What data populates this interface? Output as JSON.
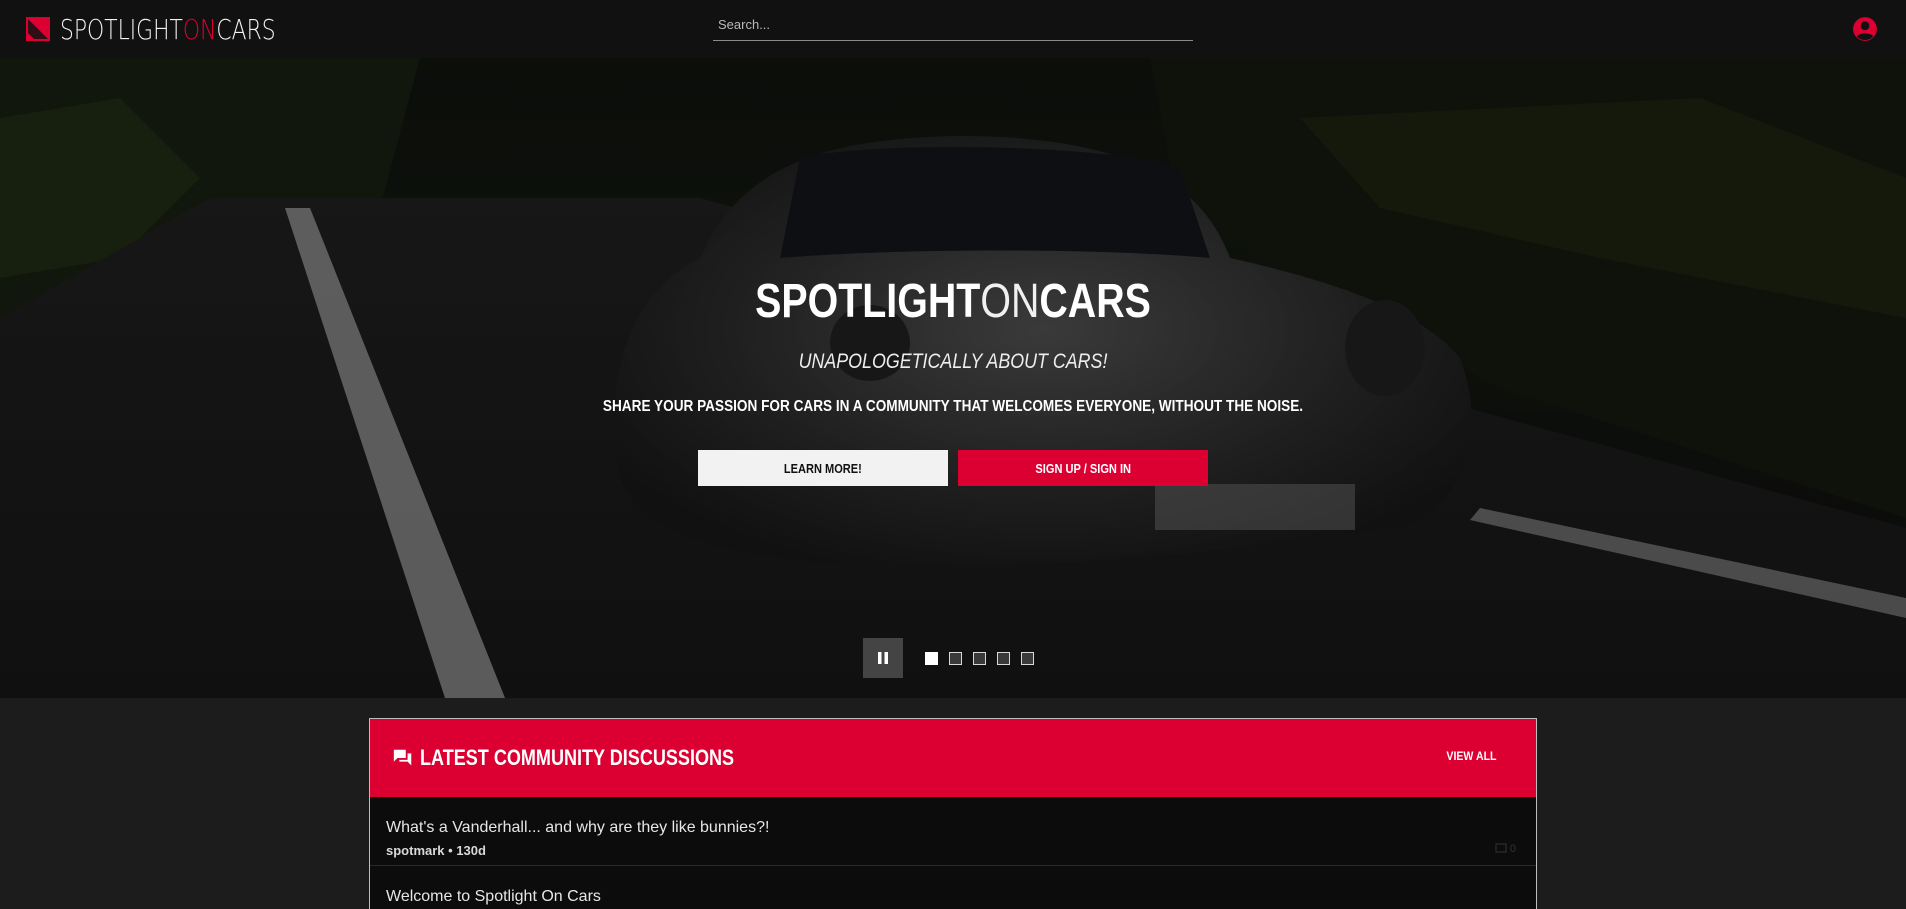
{
  "header": {
    "logo": {
      "part1": "SPOTLIGHT",
      "part2": "ON",
      "part3": "CARS"
    },
    "search_placeholder": "Search...",
    "account_icon": "account-circle-icon"
  },
  "hero": {
    "title_part1": "SPOTLIGHT",
    "title_part2": "ON",
    "title_part3": "CARS",
    "tagline": "UNAPOLOGETICALLY ABOUT CARS!",
    "description": "SHARE YOUR PASSION FOR CARS IN A COMMUNITY THAT WELCOMES EVERYONE, WITHOUT THE NOISE.",
    "learn_more_label": "LEARN MORE!",
    "signup_label": "SIGN UP / SIGN IN",
    "carousel": {
      "slide_count": 5,
      "active_index": 0,
      "pause_icon": "pause-icon"
    }
  },
  "discussions": {
    "title": "LATEST COMMUNITY DISCUSSIONS",
    "view_all_label": "VIEW ALL",
    "threads": [
      {
        "title": "What's a Vanderhall... and why are they like bunnies?!",
        "meta": "spotmark • 130d",
        "comments": "0"
      },
      {
        "title": "Welcome to Spotlight On Cars",
        "meta": "",
        "comments": ""
      }
    ]
  },
  "colors": {
    "accent": "#dc0032",
    "background": "#1c1c1c",
    "topbar": "#111111"
  }
}
